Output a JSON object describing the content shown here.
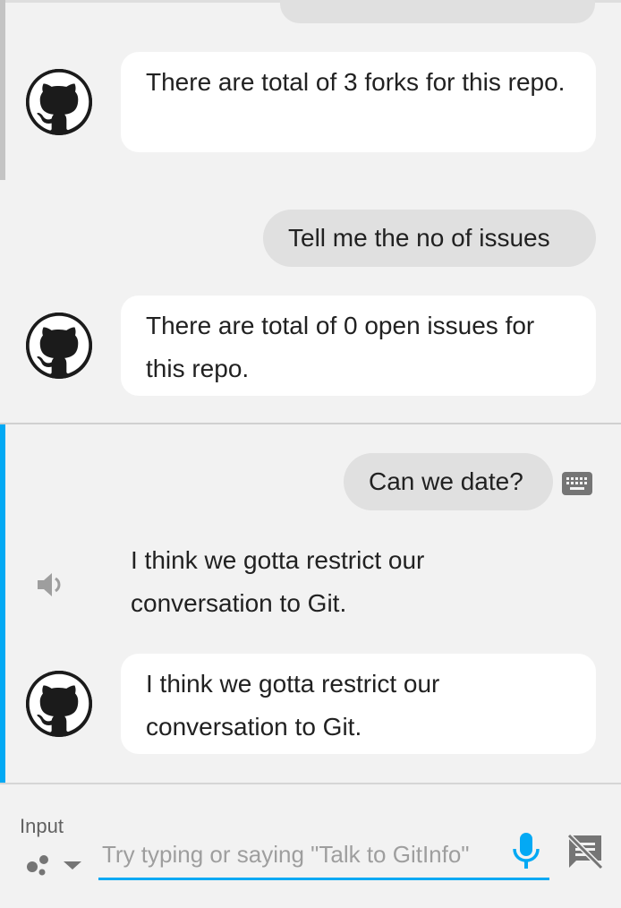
{
  "messages": {
    "bot_1": "There are total of 3 forks for this repo.",
    "user_1": "Tell me the no of issues",
    "bot_2": "There are total of 0 open issues for this repo.",
    "user_2": "Can we date?",
    "spoken_reply": "I think we gotta restrict our conversation to Git.",
    "bot_3": "I think we gotta restrict our conversation to Git."
  },
  "input": {
    "label": "Input",
    "placeholder": "Try typing or saying \"Talk to GitInfo\"",
    "value": ""
  },
  "icons": {
    "avatar": "github-octocat-icon",
    "keyboard": "keyboard-icon",
    "speaker": "speaker-icon",
    "assistant": "assistant-dots-icon",
    "mic": "mic-icon",
    "no_chat": "speech-bubble-off-icon"
  },
  "colors": {
    "accent": "#03a9f4",
    "background": "#f2f2f2",
    "user_bubble": "#e0e0e0",
    "bot_bubble": "#ffffff",
    "avatar": "#1b1b1b"
  }
}
